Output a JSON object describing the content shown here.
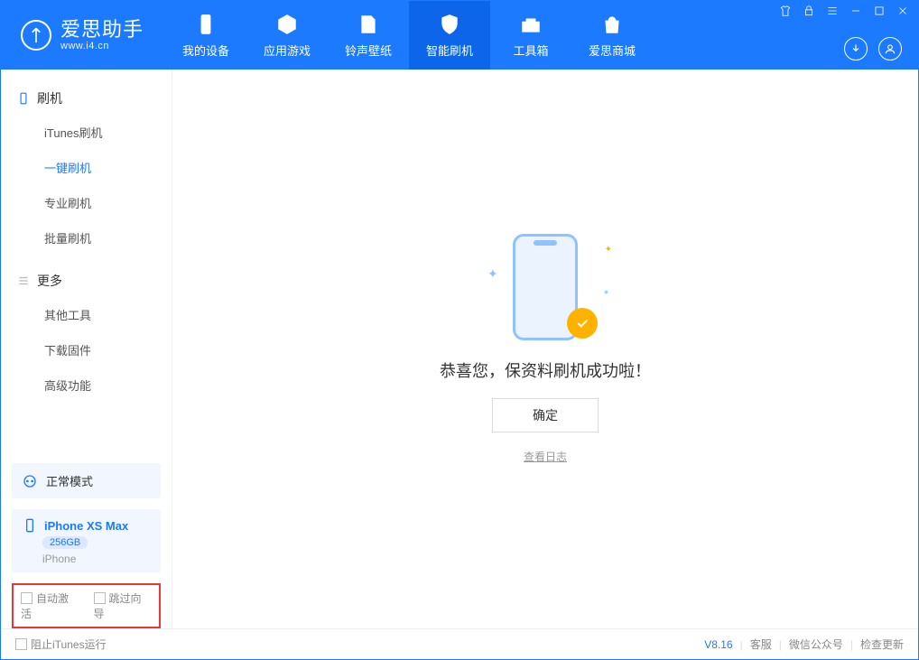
{
  "app": {
    "name": "爱思助手",
    "site": "www.i4.cn"
  },
  "tabs": {
    "device": "我的设备",
    "apps": "应用游戏",
    "ring": "铃声壁纸",
    "flash": "智能刷机",
    "tools": "工具箱",
    "store": "爱思商城"
  },
  "sidebar": {
    "group_flash": "刷机",
    "itunes_flash": "iTunes刷机",
    "one_click": "一键刷机",
    "pro_flash": "专业刷机",
    "batch_flash": "批量刷机",
    "group_more": "更多",
    "other_tools": "其他工具",
    "download_fw": "下载固件",
    "advanced": "高级功能"
  },
  "mode": {
    "label": "正常模式"
  },
  "device": {
    "name": "iPhone XS Max",
    "storage": "256GB",
    "type": "iPhone"
  },
  "opts": {
    "auto_activate": "自动激活",
    "skip_guide": "跳过向导"
  },
  "main": {
    "success_msg": "恭喜您，保资料刷机成功啦！",
    "ok": "确定",
    "view_log": "查看日志"
  },
  "footer": {
    "block_itunes": "阻止iTunes运行",
    "version": "V8.16",
    "support": "客服",
    "wechat": "微信公众号",
    "update": "检查更新"
  }
}
